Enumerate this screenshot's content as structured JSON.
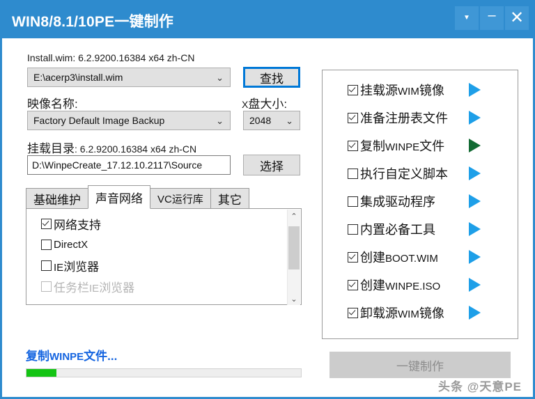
{
  "window": {
    "title": "WIN8/8.1/10PE一键制作",
    "accent_color": "#2e8bce",
    "controls": {
      "dropdown": "▼",
      "minimize": "–",
      "close": "✕"
    }
  },
  "left": {
    "install_wim": {
      "label_name": "Install.wim:",
      "label_info": " 6.2.9200.16384 x64 zh-CN",
      "value": "E:\\acerp3\\install.wim",
      "caret": "⌄",
      "find_button": "查找"
    },
    "image_name": {
      "label": "映像名称:",
      "value": "Factory Default Image Backup",
      "caret": "⌄"
    },
    "xdisk": {
      "label_en": "X",
      "label_cn": "盘大小:",
      "value": "2048",
      "caret": "⌄"
    },
    "mount_dir": {
      "label_cn": "挂载目录",
      "label_info": ": 6.2.9200.16384 x64 zh-CN",
      "value": "D:\\WinpeCreate_17.12.10.2117\\Source",
      "select_button": "选择"
    },
    "tabs": [
      {
        "label": "基础维护",
        "active": false,
        "small": false
      },
      {
        "label": "声音网络",
        "active": true,
        "small": false
      },
      {
        "label": "VC运行库",
        "active": false,
        "small": true
      },
      {
        "label": "其它",
        "active": false,
        "small": false
      }
    ],
    "tab_items": [
      {
        "label_cn": "网络支持",
        "label_en": "",
        "checked": true,
        "disabled": false
      },
      {
        "label_cn": "",
        "label_en": "DirectX",
        "checked": false,
        "disabled": false
      },
      {
        "label_cn": "浏览器",
        "label_en": "IE",
        "checked": false,
        "disabled": false
      },
      {
        "label_cn": "任务栏",
        "label_en": "IE",
        "label_cn2": "浏览器",
        "checked": false,
        "disabled": true
      }
    ],
    "scrollbar": {
      "up": "⌃",
      "down": "⌄"
    },
    "status": {
      "text_cn": "复制",
      "text_en": "WINPE",
      "text_cn2": "文件...",
      "color": "#1464e0"
    },
    "progress": {
      "percent": 11,
      "fill_color": "#14c414"
    }
  },
  "right": {
    "steps": [
      {
        "label_cn": "挂载源",
        "label_en": "WIM",
        "label_cn2": "镜像",
        "checked": true,
        "active": false
      },
      {
        "label_cn": "准备注册表文件",
        "label_en": "",
        "label_cn2": "",
        "checked": true,
        "active": false
      },
      {
        "label_cn": "复制",
        "label_en": "WINPE",
        "label_cn2": "文件",
        "checked": true,
        "active": true
      },
      {
        "label_cn": "执行自定义脚本",
        "label_en": "",
        "label_cn2": "",
        "checked": false,
        "active": false
      },
      {
        "label_cn": "集成驱动程序",
        "label_en": "",
        "label_cn2": "",
        "checked": false,
        "active": false
      },
      {
        "label_cn": "内置必备工具",
        "label_en": "",
        "label_cn2": "",
        "checked": false,
        "active": false
      },
      {
        "label_cn": "创建",
        "label_en": "BOOT.WIM",
        "label_cn2": "",
        "checked": true,
        "active": false
      },
      {
        "label_cn": "创建",
        "label_en": "WINPE.ISO",
        "label_cn2": "",
        "checked": true,
        "active": false
      },
      {
        "label_cn": "卸载源",
        "label_en": "WIM",
        "label_cn2": "镜像",
        "checked": true,
        "active": false
      }
    ],
    "make_button": "一键制作",
    "arrow_color": "#1e9fe8",
    "arrow_active_color": "#136b34"
  },
  "watermark": "头条 @天意PE"
}
